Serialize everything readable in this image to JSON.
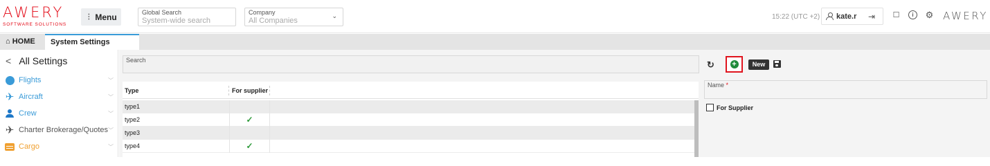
{
  "header": {
    "logo_text": "AWERY",
    "logo_sub": "SOFTWARE SOLUTIONS",
    "menu_label": "Menu",
    "global_search": {
      "label": "Global Search",
      "placeholder": "System-wide search"
    },
    "company": {
      "label": "Company",
      "value": "All Companies"
    },
    "time": "15:22 (UTC +2)",
    "user_name": "kate.r",
    "brand": "AWERY"
  },
  "tabs": [
    {
      "label": "HOME",
      "icon": "home-icon"
    },
    {
      "label": "System Settings",
      "active": true
    }
  ],
  "sidebar": {
    "title": "All Settings",
    "items": [
      {
        "label": "Flights",
        "icon": "flights-icon",
        "color": "#3a9bd8"
      },
      {
        "label": "Aircraft",
        "icon": "aircraft-icon",
        "color": "#3a9bd8"
      },
      {
        "label": "Crew",
        "icon": "crew-icon",
        "color": "#1e78c8"
      },
      {
        "label": "Charter Brokerage/Quotes",
        "icon": "charter-icon",
        "color": "#555555"
      },
      {
        "label": "Cargo",
        "icon": "cargo-icon",
        "color": "#f0a030"
      }
    ]
  },
  "list": {
    "search_label": "Search",
    "columns": [
      "Type",
      "For supplier"
    ],
    "rows": [
      {
        "type": "type1",
        "for_supplier": false
      },
      {
        "type": "type2",
        "for_supplier": true
      },
      {
        "type": "type3",
        "for_supplier": false
      },
      {
        "type": "type4",
        "for_supplier": true
      }
    ]
  },
  "form": {
    "new_label": "New",
    "name_label": "Name",
    "required_mark": "*",
    "for_supplier_label": "For Supplier",
    "for_supplier_checked": false
  },
  "colors": {
    "accent": "#3a9bd8",
    "brand_red": "#e30613",
    "add_green": "#1f8a3a",
    "highlight_red": "#e0141e"
  }
}
